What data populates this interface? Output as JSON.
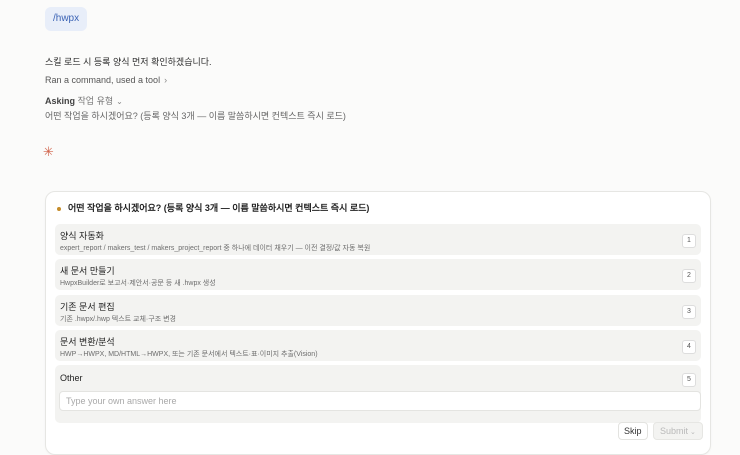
{
  "command_chip": "/hwpx",
  "messages": {
    "line1": "스킬 로드 시 등록 양식 먼저 확인하겠습니다.",
    "tool_summary": "Ran a command, used a tool",
    "asking_label": "Asking",
    "asking_topic": "작업 유형",
    "question_text": "어떤 작업을 하시겠어요? (등록 양식 3개 — 이름 말씀하시면 컨텍스트 즉시 로드)"
  },
  "question_card": {
    "title": "어떤 작업을 하시겠어요? (등록 양식 3개 — 이름 말씀하시면 컨텍스트 즉시 로드)",
    "options": [
      {
        "title": "양식 자동화",
        "desc": "expert_report / makers_test / makers_project_report 중 하나에 데이터 채우기 — 이전 결정/값 자동 복원",
        "num": "1"
      },
      {
        "title": "새 문서 만들기",
        "desc": "HwpxBuilder로 보고서·제안서·공문 등 새 .hwpx 생성",
        "num": "2"
      },
      {
        "title": "기존 문서 편집",
        "desc": "기존 .hwpx/.hwp 텍스트 교체·구조 변경",
        "num": "3"
      },
      {
        "title": "문서 변환/분석",
        "desc": "HWP→HWPX, MD/HTML→HWPX, 또는 기존 문서에서 텍스트·표·이미지 추출(Vision)",
        "num": "4"
      }
    ],
    "other": {
      "title": "Other",
      "num": "5",
      "placeholder": "Type your own answer here",
      "value": ""
    },
    "skip_label": "Skip",
    "submit_label": "Submit"
  },
  "colors": {
    "chip_bg": "#e8eef9",
    "chip_text": "#3b63b5",
    "spark": "#d0634a",
    "dot": "#c58c2a"
  },
  "icons": {
    "chevron_right": "›",
    "chevron_down": "⌄",
    "spark": "✳",
    "submit_caret": "⌄"
  }
}
